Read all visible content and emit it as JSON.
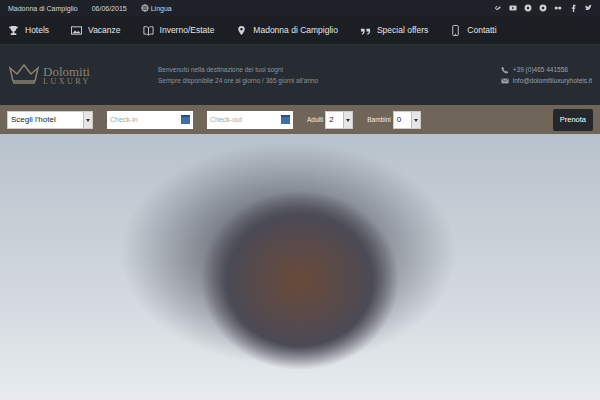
{
  "top_bar": {
    "location": "Madonna di Campiglio",
    "date": "06/06/2015",
    "language": "Lingua"
  },
  "nav": [
    {
      "label": "Hotels"
    },
    {
      "label": "Vacanze"
    },
    {
      "label": "Inverno/Estate"
    },
    {
      "label": "Madonna di Campiglio"
    },
    {
      "label": "Special offers"
    },
    {
      "label": "Contatti"
    }
  ],
  "logo": {
    "name": "Dolomiti",
    "sub": "LUXURY"
  },
  "welcome": [
    "Benvenuto nella destinazione dei tuoi sogni",
    "Sempre disponibile 24 ore al giorno / 365 giorni all'anno"
  ],
  "contact": {
    "phone": "+39 (0)465 441558",
    "email": "info@dolomitiluxuryhotels.it"
  },
  "booking": {
    "hotel": "Scegli l'hotel",
    "checkin": "Check-in",
    "checkout": "Check-out",
    "adults_label": "Adulti",
    "adults": "2",
    "children_label": "Bambini",
    "children": "0",
    "button": "Prenota"
  }
}
